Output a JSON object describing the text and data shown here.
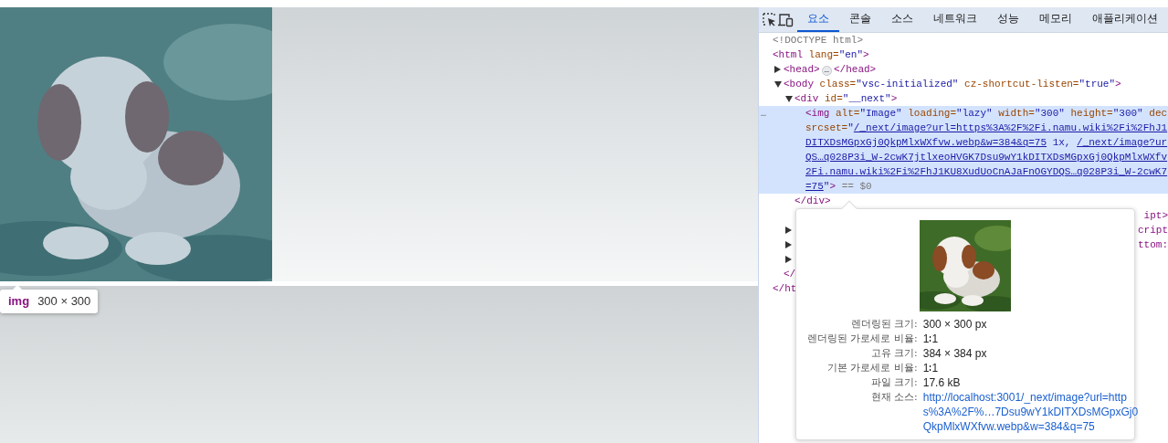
{
  "page": {
    "element_label": {
      "tag": "img",
      "size": "300 × 300"
    }
  },
  "devtools": {
    "tabs": [
      {
        "label": "요소",
        "selected": true
      },
      {
        "label": "콘솔",
        "selected": false
      },
      {
        "label": "소스",
        "selected": false
      },
      {
        "label": "네트워크",
        "selected": false
      },
      {
        "label": "성능",
        "selected": false
      },
      {
        "label": "메모리",
        "selected": false
      },
      {
        "label": "애플리케이션",
        "selected": false
      }
    ],
    "tree": [
      {
        "expandable": false,
        "selected": false,
        "lines": [
          [
            {
              "kind": "muted",
              "text": "<!DOCTYPE html>"
            }
          ]
        ]
      },
      {
        "expandable": false,
        "selected": false,
        "lines": [
          [
            {
              "kind": "tag",
              "text": "<html "
            },
            {
              "kind": "attr",
              "text": "lang="
            },
            {
              "kind": "value",
              "text": "\"en\""
            },
            {
              "kind": "tag",
              "text": ">"
            }
          ]
        ],
        "close": [
          {
            "kind": "tag",
            "text": "</ht"
          }
        ],
        "children": [
          {
            "expandable": true,
            "expanded": false,
            "selected": false,
            "lines": [
              [
                {
                  "kind": "tag",
                  "text": "<head>"
                },
                {
                  "kind": "badge",
                  "text": "…"
                },
                {
                  "kind": "tag",
                  "text": "</head>"
                }
              ]
            ]
          },
          {
            "expandable": true,
            "expanded": true,
            "selected": false,
            "lines": [
              [
                {
                  "kind": "tag",
                  "text": "<body "
                },
                {
                  "kind": "attr",
                  "text": "class="
                },
                {
                  "kind": "value",
                  "text": "\"vsc-initialized\" "
                },
                {
                  "kind": "attr",
                  "text": "cz-shortcut-listen="
                },
                {
                  "kind": "value",
                  "text": "\"true\""
                },
                {
                  "kind": "tag",
                  "text": ">"
                }
              ]
            ],
            "close": [
              {
                "kind": "tag",
                "text": "</"
              }
            ],
            "children": [
              {
                "expandable": true,
                "expanded": true,
                "selected": false,
                "lines": [
                  [
                    {
                      "kind": "tag",
                      "text": "<div "
                    },
                    {
                      "kind": "attr",
                      "text": "id="
                    },
                    {
                      "kind": "value",
                      "text": "\"__next\""
                    },
                    {
                      "kind": "tag",
                      "text": ">"
                    }
                  ]
                ],
                "close": [
                  {
                    "kind": "tag",
                    "text": "</div>"
                  }
                ],
                "children": [
                  {
                    "expandable": false,
                    "selected": true,
                    "gutter": "…",
                    "lines": [
                      [
                        {
                          "kind": "tag",
                          "text": "<img "
                        },
                        {
                          "kind": "attr",
                          "text": "alt="
                        },
                        {
                          "kind": "value",
                          "text": "\"Image\" "
                        },
                        {
                          "kind": "attr",
                          "text": "loading="
                        },
                        {
                          "kind": "value",
                          "text": "\"lazy\" "
                        },
                        {
                          "kind": "attr",
                          "text": "width="
                        },
                        {
                          "kind": "value",
                          "text": "\"300\" "
                        },
                        {
                          "kind": "attr",
                          "text": "height="
                        },
                        {
                          "kind": "value",
                          "text": "\"300\" "
                        },
                        {
                          "kind": "attr",
                          "text": "dec"
                        }
                      ],
                      [
                        {
                          "kind": "attr",
                          "text": "srcset="
                        },
                        {
                          "kind": "value",
                          "text": "\""
                        },
                        {
                          "kind": "link",
                          "text": "/_next/image?url=https%3A%2F%2Fi.namu.wiki%2Fi%2FhJ1"
                        }
                      ],
                      [
                        {
                          "kind": "link",
                          "text": "DITXDsMGpxGj0QkpMlxWXfvw.webp&w=384&q=75"
                        },
                        {
                          "kind": "value",
                          "text": " 1x, "
                        },
                        {
                          "kind": "link",
                          "text": "/_next/image?ur"
                        }
                      ],
                      [
                        {
                          "kind": "link",
                          "text": "QS…q028P3i_W-2cwK7jtlxeoHVGK7Dsu9wY1kDITXDsMGpxGj0QkpMlxWXfv"
                        }
                      ],
                      [
                        {
                          "kind": "link",
                          "text": "2Fi.namu.wiki%2Fi%2FhJ1KU8XudUoCnAJaFnOGYDQS…q028P3i_W-2cwK7"
                        }
                      ],
                      [
                        {
                          "kind": "link",
                          "text": "=75"
                        },
                        {
                          "kind": "value",
                          "text": "\""
                        },
                        {
                          "kind": "tag",
                          "text": ">"
                        },
                        {
                          "kind": "muted",
                          "text": " == $0"
                        }
                      ]
                    ]
                  }
                ]
              },
              {
                "expandable": false,
                "selected": false,
                "tail": "ipt>"
              },
              {
                "expandable": true,
                "expanded": false,
                "selected": false,
                "tail": "cript"
              },
              {
                "expandable": true,
                "expanded": false,
                "selected": false,
                "tail": "ttom:"
              },
              {
                "expandable": true,
                "expanded": false,
                "selected": false
              }
            ]
          }
        ]
      }
    ],
    "popover": {
      "rows": [
        {
          "label": "렌더링된 크기:",
          "value": "300 × 300 px",
          "kind": "text"
        },
        {
          "label": "렌더링된 가로세로 비율:",
          "value": "1∶1",
          "kind": "text"
        },
        {
          "label": "고유 크기:",
          "value": "384 × 384 px",
          "kind": "text"
        },
        {
          "label": "기본 가로세로 비율:",
          "value": "1∶1",
          "kind": "text"
        },
        {
          "label": "파일 크기:",
          "value": "17.6 kB",
          "kind": "text"
        },
        {
          "label": "현재 소스:",
          "value": "http://localhost:3001/_next/image?url=https%3A%2F%…7Dsu9wY1kDITXDsMGpxGj0QkpMlxWXfvw.webp&w=384&q=75",
          "kind": "link"
        }
      ]
    }
  }
}
